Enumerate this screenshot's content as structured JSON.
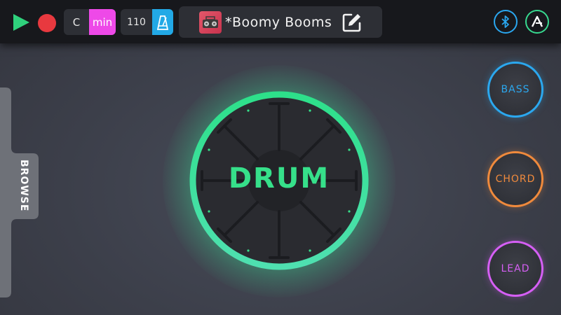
{
  "topbar": {
    "play_icon": "play-icon",
    "record_icon": "record-icon",
    "key": {
      "note": "C",
      "scale": "min"
    },
    "tempo": {
      "bpm": "110",
      "metronome_icon": "metronome-icon"
    },
    "song": {
      "title": "*Boomy Booms",
      "art_icon": "boombox-icon",
      "edit_icon": "edit-icon"
    },
    "bluetooth_icon": "bluetooth-icon",
    "account_icon": "logo-a-icon"
  },
  "browse": {
    "label": "BROWSE"
  },
  "drum_pad": {
    "label": "DRUM"
  },
  "instruments": {
    "bass": "BASS",
    "chord": "CHORD",
    "lead": "LEAD"
  },
  "colors": {
    "play": "#2fd17c",
    "record": "#e8393f",
    "scale": "#ee49e8",
    "metronome": "#22a9e6",
    "drum": "#36e08a",
    "bass": "#2ba8ef",
    "chord": "#f08a3c",
    "lead": "#d65ff5"
  }
}
